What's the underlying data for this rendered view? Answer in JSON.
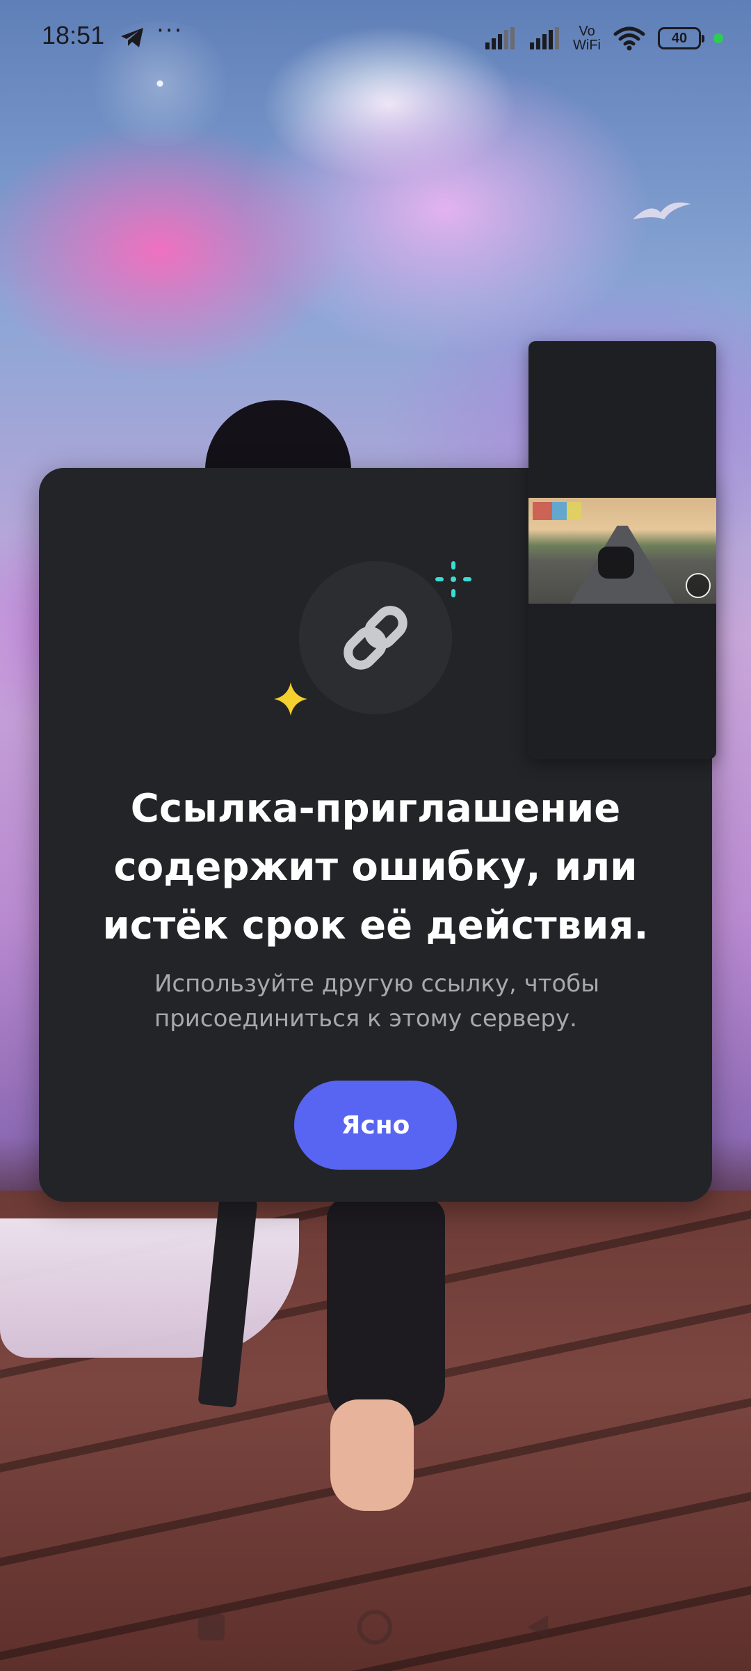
{
  "status_bar": {
    "time": "18:51",
    "notification_icons": [
      "telegram-icon",
      "more-dots-icon"
    ],
    "more_label": "···",
    "network_label_top": "Vo",
    "network_label_bottom": "WiFi",
    "battery_level": "40"
  },
  "dialog": {
    "icon": "link-icon",
    "title": "Ссылка-приглашение содержит ошибку, или истёк срок её действия.",
    "subtitle": "Используйте другую ссылку, чтобы присоединиться к этому серверу.",
    "confirm_label": "Ясно"
  },
  "colors": {
    "dialog_background": "#232428",
    "icon_circle": "#2c2d31",
    "button": "#5865f2",
    "title_text": "#ffffff",
    "subtitle_text": "#a7a8ad",
    "sparkle_teal": "#3ddbd0",
    "sparkle_yellow": "#f5d02e"
  },
  "nav_bar": {
    "buttons": [
      "recents-button",
      "home-button",
      "back-button"
    ]
  }
}
